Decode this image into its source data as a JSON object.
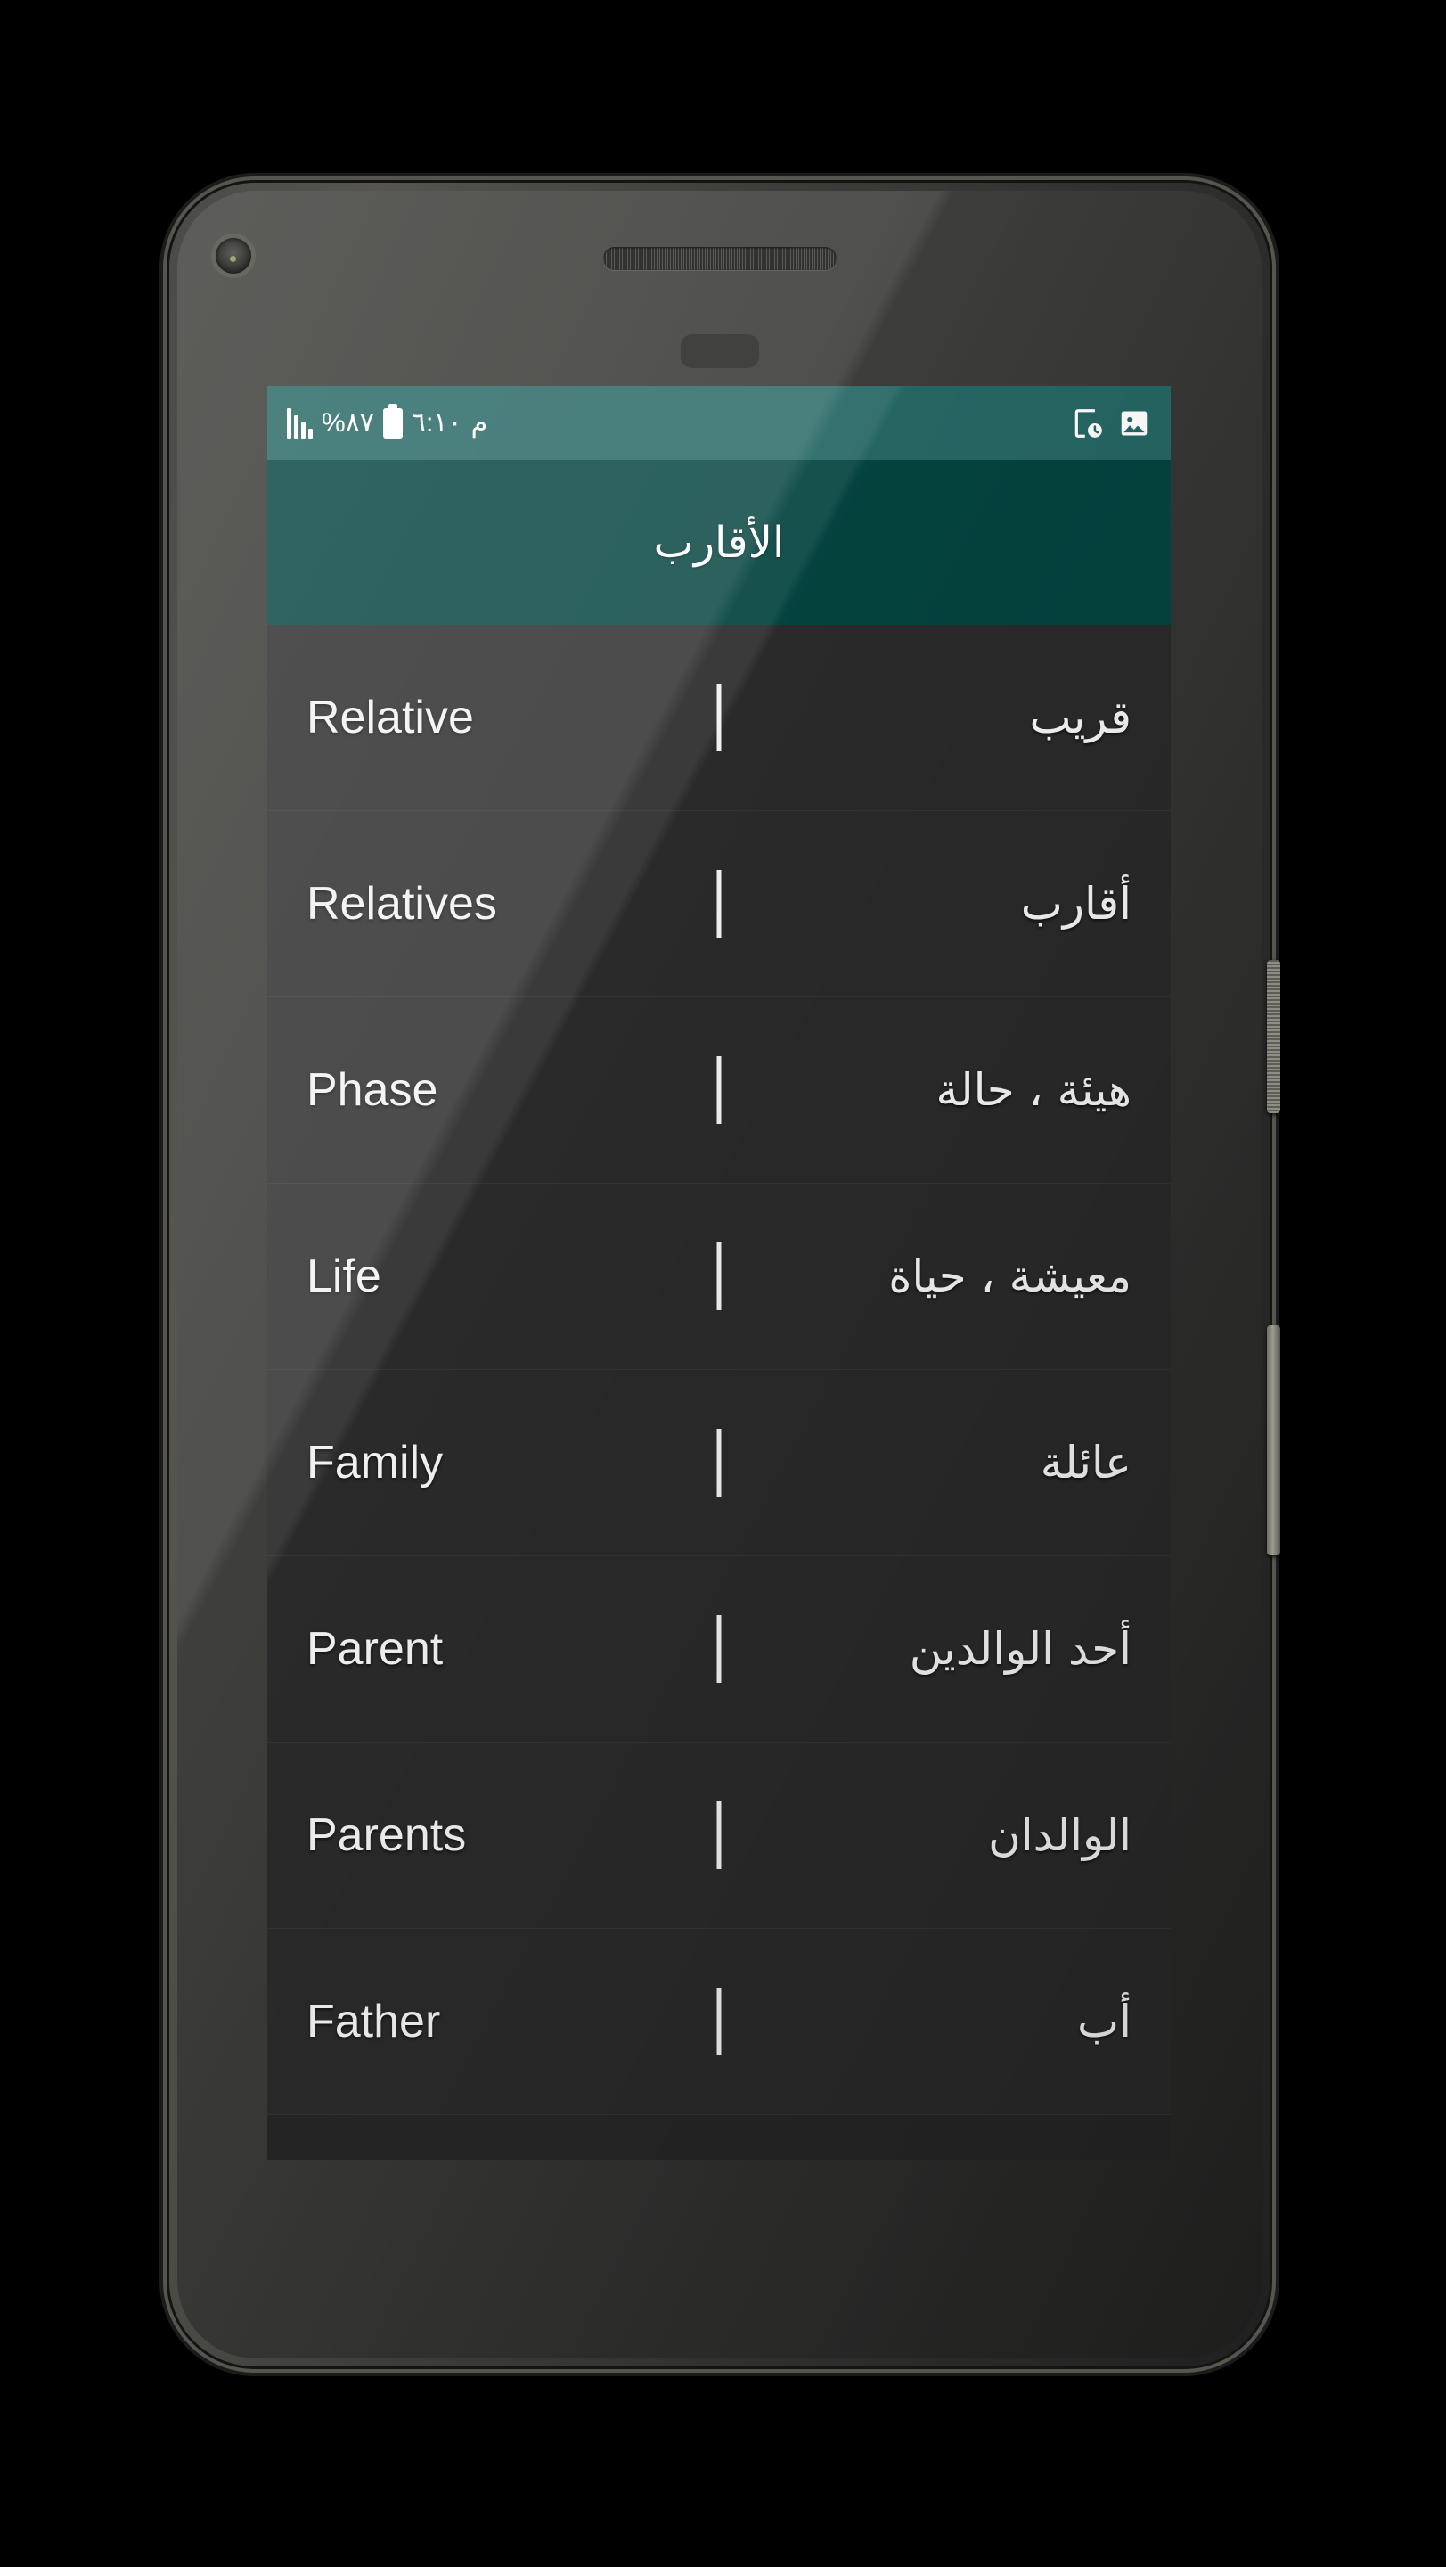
{
  "status_bar": {
    "time": "٦:١٠",
    "meridiem": "م",
    "battery_percent": "٨٧%",
    "icons": {
      "battery": "battery-icon",
      "signal": "signal-bars-icon",
      "screen_time": "phone-clock-icon",
      "gallery": "image-icon"
    },
    "background_color": "#256663"
  },
  "app_bar": {
    "title": "الأقارب",
    "background_color": "#04433F",
    "text_color": "#FFFFFF"
  },
  "list": {
    "background_color": "#2A2A2A",
    "divider_color": "#343434",
    "rows": [
      {
        "english": "Relative",
        "arabic": "قريب"
      },
      {
        "english": "Relatives",
        "arabic": "أقارب"
      },
      {
        "english": "Phase",
        "arabic": "هيئة ، حالة"
      },
      {
        "english": "Life",
        "arabic": "معيشة ، حياة"
      },
      {
        "english": "Family",
        "arabic": "عائلة"
      },
      {
        "english": "Parent",
        "arabic": "أحد الوالدين"
      },
      {
        "english": "Parents",
        "arabic": "الوالدان"
      },
      {
        "english": "Father",
        "arabic": "أب"
      }
    ]
  },
  "device": {
    "hardware": {
      "front_camera": "front-camera",
      "earpiece": "earpiece-speaker",
      "proximity_sensor": "proximity-sensor",
      "power_button": "power-button",
      "volume_button": "volume-button"
    }
  }
}
